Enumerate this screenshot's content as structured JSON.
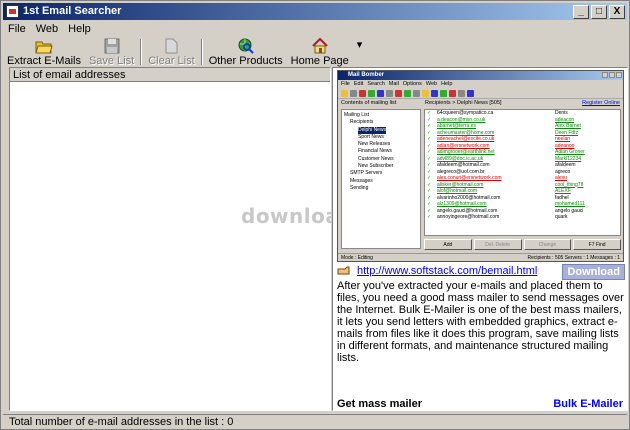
{
  "window": {
    "title": "1st Email Searcher",
    "min": "_",
    "max": "□",
    "close": "X"
  },
  "menu": [
    "File",
    "Web",
    "Help"
  ],
  "toolbar": {
    "extract": "Extract E-Mails",
    "save": "Save List",
    "clear": "Clear List",
    "products": "Other Products",
    "home": "Home Page",
    "more": "▾"
  },
  "left_panel": {
    "header": "List of email addresses",
    "watermark": "download"
  },
  "status": {
    "text": "Total number of e-mail addresses in the list : 0"
  },
  "preview": {
    "title": "Mail Bomber",
    "menu": [
      "File",
      "Edit",
      "Search",
      "Mail",
      "Options",
      "Web",
      "Help"
    ],
    "left_header": "Contents of mailing list",
    "right_header": "Recipients > Delphi News [505]",
    "register": "Register Online",
    "tree": [
      "Mailing List",
      "Recipients",
      "Delphi News",
      "Sport News",
      "New Releases",
      "Financial News",
      "Customer News",
      "New Subscriber",
      "SMTP Servers",
      "Messages",
      "Sending"
    ],
    "rows": [
      {
        "email": "64cqueen@sympatico.ca",
        "name": "Denis",
        "style": ""
      },
      {
        "email": "a.deacon@msn.co.uk",
        "name": "adeacon",
        "style": "g"
      },
      {
        "email": "abarnet@terra.es",
        "name": "Alex Barnet",
        "style": "g"
      },
      {
        "email": "acheumaster@home.com",
        "name": "Deen Fdtz",
        "style": "g"
      },
      {
        "email": "adeneachel@excite.co.uk",
        "name": "neelan",
        "style": "r"
      },
      {
        "email": "adian@ersnetwork.com",
        "name": "adeanoo",
        "style": "r"
      },
      {
        "email": "adimgrooer@earthlink.net",
        "name": "Adian Groner",
        "style": "g"
      },
      {
        "email": "advl89@doc.ic.ac.uk",
        "name": "Markl12234",
        "style": "g"
      },
      {
        "email": "afaldeem@hotmail.com",
        "name": "afaldeem",
        "style": ""
      },
      {
        "email": "alegreco@uol.com.br",
        "name": "agreco",
        "style": ""
      },
      {
        "email": "alex.conuri@ersnetwork.com",
        "name": "alexu",
        "style": "r"
      },
      {
        "email": "alisker@hotmail.com",
        "name": "cool_thing78",
        "style": "g"
      },
      {
        "email": "alof@hotmail.com",
        "name": "ALEXF",
        "style": "g"
      },
      {
        "email": "alvarinho2000@hotmail.com",
        "name": "fadhel",
        "style": ""
      },
      {
        "email": "alz1309@hotmail.com",
        "name": "mohamed111",
        "style": "g"
      },
      {
        "email": "angelo.gauci@hotmail.com",
        "name": "angelo gauci",
        "style": ""
      },
      {
        "email": "annoyingeore@hotmail.com",
        "name": "quark",
        "style": ""
      }
    ],
    "buttons": [
      "Add",
      "Del. Delete",
      "Change",
      "F7 Find"
    ],
    "status_left": "Mode : Editing",
    "status_right": "Recipients : 505  Servers : 1  Messages : 1"
  },
  "info": {
    "url": "http://www.softstack.com/bemail.html",
    "download": "Download",
    "description": "After you've extracted your e-mails and placed them to files, you need a good mass mailer to send messages over the Internet. Bulk E-Mailer is one of the best mass mailers, it lets you send letters with embedded graphics, extract e-mails from files like it does this program, save mailing lists in different formats, and maintenance structured mailing lists.",
    "get_mass": "Get mass mailer",
    "bulk": "Bulk E-Mailer"
  },
  "colors": {
    "title_start": "#0a246a",
    "title_end": "#a6caf0",
    "link": "#0000ff",
    "face": "#d4d0c8"
  }
}
